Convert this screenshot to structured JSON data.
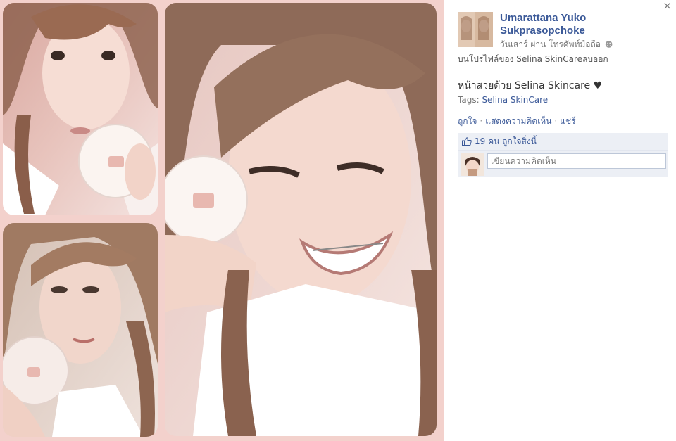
{
  "close": {
    "label": "×"
  },
  "post": {
    "author": "Umarattana Yuko Sukprasopchoke",
    "meta": "วันเสาร์ ผ่าน โทรศัพท์มือถือ",
    "posted_on": "บนโปรไฟล์ของ Selina SkinCareลบออก",
    "caption": "หน้าสวยด้วย Selina Skincare ♥",
    "tags_label": "Tags:",
    "tags_value": "Selina SkinCare"
  },
  "actions": {
    "like": "ถูกใจ",
    "comment": "แสดงความคิดเห็น",
    "share": "แชร์",
    "separator": "·"
  },
  "likes": {
    "text": "19 คน ถูกใจสิ่งนี้"
  },
  "comment": {
    "placeholder": "เขียนความคิดเห็น"
  },
  "colors": {
    "link": "#3b5998",
    "frame": "#f3d1cc",
    "ufi_bg": "#eceff5"
  },
  "icons": [
    "close-icon",
    "people-icon",
    "thumbs-up-icon"
  ]
}
